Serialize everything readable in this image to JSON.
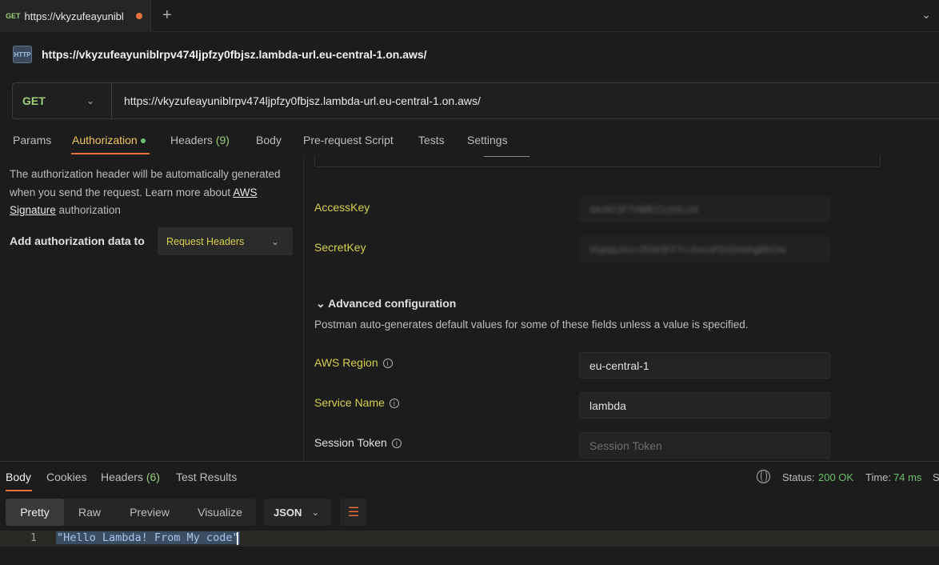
{
  "tab": {
    "method": "GET",
    "title": "https://vkyzufeayunibl",
    "new_tab_icon": "+",
    "menu_icon": "⌄"
  },
  "request": {
    "icon_label": "HTTP",
    "title": "https://vkyzufeayuniblrpv474ljpfzy0fbjsz.lambda-url.eu-central-1.on.aws/",
    "method": "GET",
    "url": "https://vkyzufeayuniblrpv474ljpfzy0fbjsz.lambda-url.eu-central-1.on.aws/"
  },
  "request_tabs": [
    {
      "label": "Params"
    },
    {
      "label": "Authorization"
    },
    {
      "label": "Headers",
      "count": "(9)"
    },
    {
      "label": "Body"
    },
    {
      "label": "Pre-request Script"
    },
    {
      "label": "Tests"
    },
    {
      "label": "Settings"
    }
  ],
  "auth": {
    "desc_before": "The authorization header will be automatically generated when you send the request. Learn more about ",
    "desc_link": "AWS Signature",
    "desc_after": " authorization",
    "add_label": "Add authorization data to",
    "add_value": "Request Headers",
    "access_key_label": "AccessKey",
    "access_key_value": "AKIAT2FTHMECU2XLUV",
    "secret_key_label": "SecretKey",
    "secret_key_value": "tXqhjaJXo+ZKW3FFY+Jun/uPEhDnbhgBKOw",
    "advanced_label": "Advanced configuration",
    "advanced_desc": "Postman auto-generates default values for some of these fields unless a value is specified.",
    "region_label": "AWS Region",
    "region_value": "eu-central-1",
    "service_label": "Service Name",
    "service_value": "lambda",
    "session_label": "Session Token",
    "session_placeholder": "Session Token"
  },
  "response": {
    "tabs": [
      {
        "label": "Body"
      },
      {
        "label": "Cookies"
      },
      {
        "label": "Headers",
        "count": "(6)"
      },
      {
        "label": "Test Results"
      }
    ],
    "status_label": "Status:",
    "status_value": "200 OK",
    "time_label": "Time:",
    "time_value": "74 ms",
    "size_label": "S",
    "views": [
      "Pretty",
      "Raw",
      "Preview",
      "Visualize"
    ],
    "format": "JSON",
    "line_number": "1",
    "body": "\"Hello Lambda! From My code\""
  }
}
